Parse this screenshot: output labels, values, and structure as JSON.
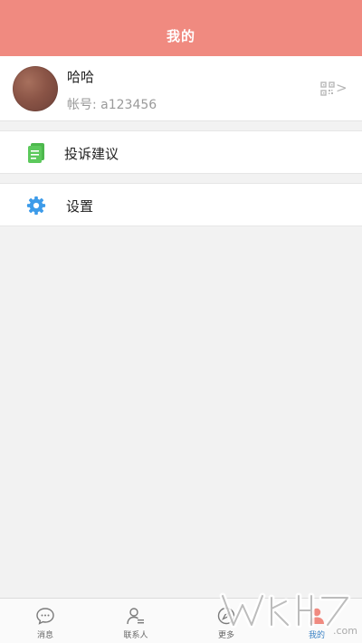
{
  "header": {
    "title": "我的"
  },
  "profile": {
    "name": "哈哈",
    "account": "帐号: a123456",
    "chevron": ">"
  },
  "menu": [
    {
      "label": "投诉建议",
      "icon": "document-icon"
    },
    {
      "label": "设置",
      "icon": "gear-icon"
    }
  ],
  "tabbar": [
    {
      "label": "消息",
      "icon": "message-icon"
    },
    {
      "label": "联系人",
      "icon": "contact-icon"
    },
    {
      "label": "更多",
      "icon": "compass-icon"
    },
    {
      "label": "我的",
      "icon": "user-icon",
      "active": true
    }
  ],
  "watermark": {
    "text": "9k9.com"
  },
  "colors": {
    "header_bg": "#f08a80",
    "complaint_icon": "#5cc95c",
    "settings_icon": "#3d9be9",
    "active_tab": "#3b82c4",
    "active_user_icon": "#f08a80"
  }
}
